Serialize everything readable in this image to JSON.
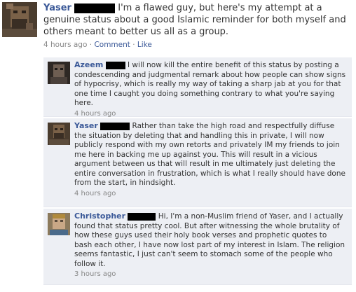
{
  "post": {
    "author": "Yaser",
    "text": "I'm a flawed guy, but here's my attempt at a genuine status about a good Islamic reminder for both myself and others meant to better us all as a group.",
    "time": "4 hours ago",
    "separator1": "·",
    "comment_link": "Comment",
    "separator2": "·",
    "like_link": "Like"
  },
  "comments": [
    {
      "author": "Azeem",
      "text": "I will now kill the entire benefit of this status by posting a condescending and judgmental remark about how people can show signs of hypocrisy, which is really my way of taking a sharp jab at you for that one time I caught you doing something contrary to what you're saying here.",
      "time": "4 hours ago"
    },
    {
      "author": "Yaser",
      "text": "Rather than take the high road and respectfully diffuse the situation by deleting that and handling this in private, I will now publicly respond with my own retorts and privately IM my friends to join me here in backing me up against you. This will result in a vicious argument between us that will result in me ultimately just deleting the entire conversation in frustration, which is what I really should have done from the start, in hindsight.",
      "time": "4 hours ago"
    },
    {
      "author": "Christopher",
      "text": "Hi, I'm a non-Muslim friend of Yaser, and I actually found that status pretty cool. But after witnessing the whole brutality of how these guys used their holy book verses and prophetic quotes to bash each other, I have now lost part of my interest in Islam. The religion seems fantastic, I just can't seem to stomach some of the people who follow it.",
      "time": "3 hours ago"
    }
  ]
}
